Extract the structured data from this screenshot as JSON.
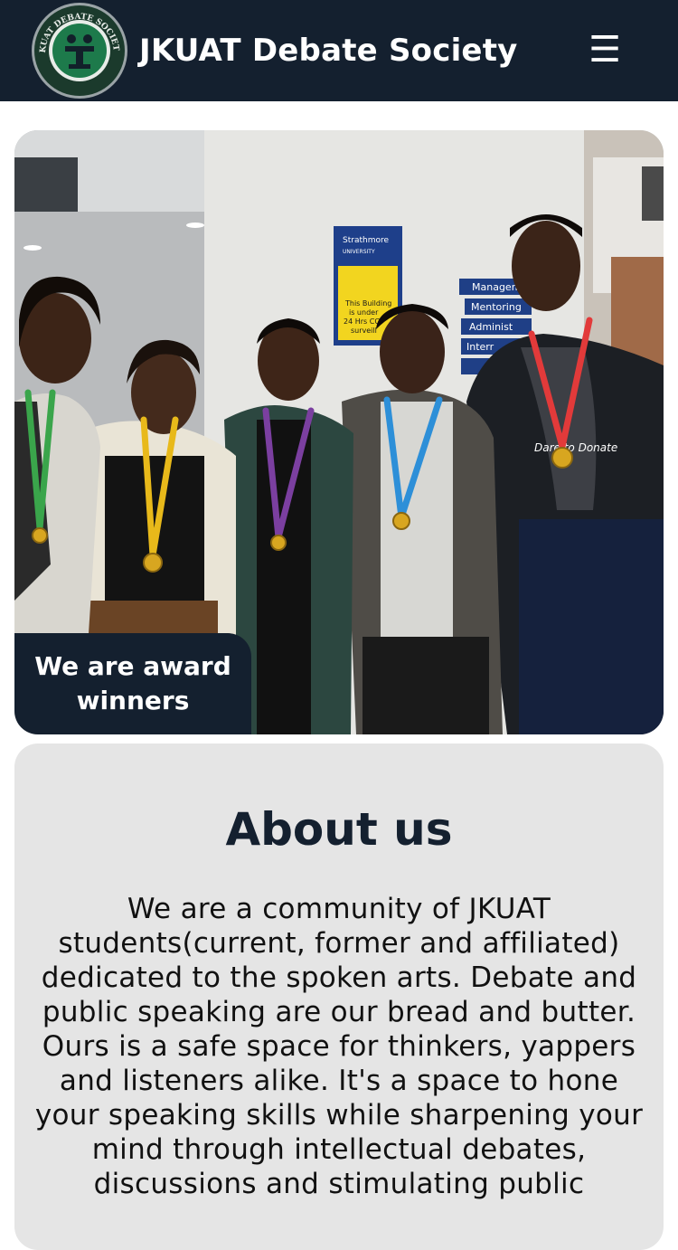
{
  "header": {
    "logo_text": "JKUAT DEBATE SOCIETY",
    "title": "JKUAT Debate Society",
    "menu_icon": "☰"
  },
  "hero": {
    "caption": "We are award winners",
    "sign": {
      "university": "Strathmore",
      "university_sub": "UNIVERSITY",
      "notice": [
        "This Building",
        "is under",
        "24 Hrs CC",
        "surveill"
      ]
    },
    "directory": [
      "Managem",
      "Mentoring",
      "Administ",
      "Interr"
    ],
    "shirt_text": "Dare to Donate"
  },
  "about": {
    "title": "About us",
    "body": "We are a community of JKUAT students(current, former and affiliated) dedicated to the spoken arts. Debate and public speaking are our bread and butter. Ours is a safe space for thinkers, yappers and listeners alike. It's a space to hone your speaking skills while sharpening your mind through intellectual debates, discussions and stimulating public"
  }
}
